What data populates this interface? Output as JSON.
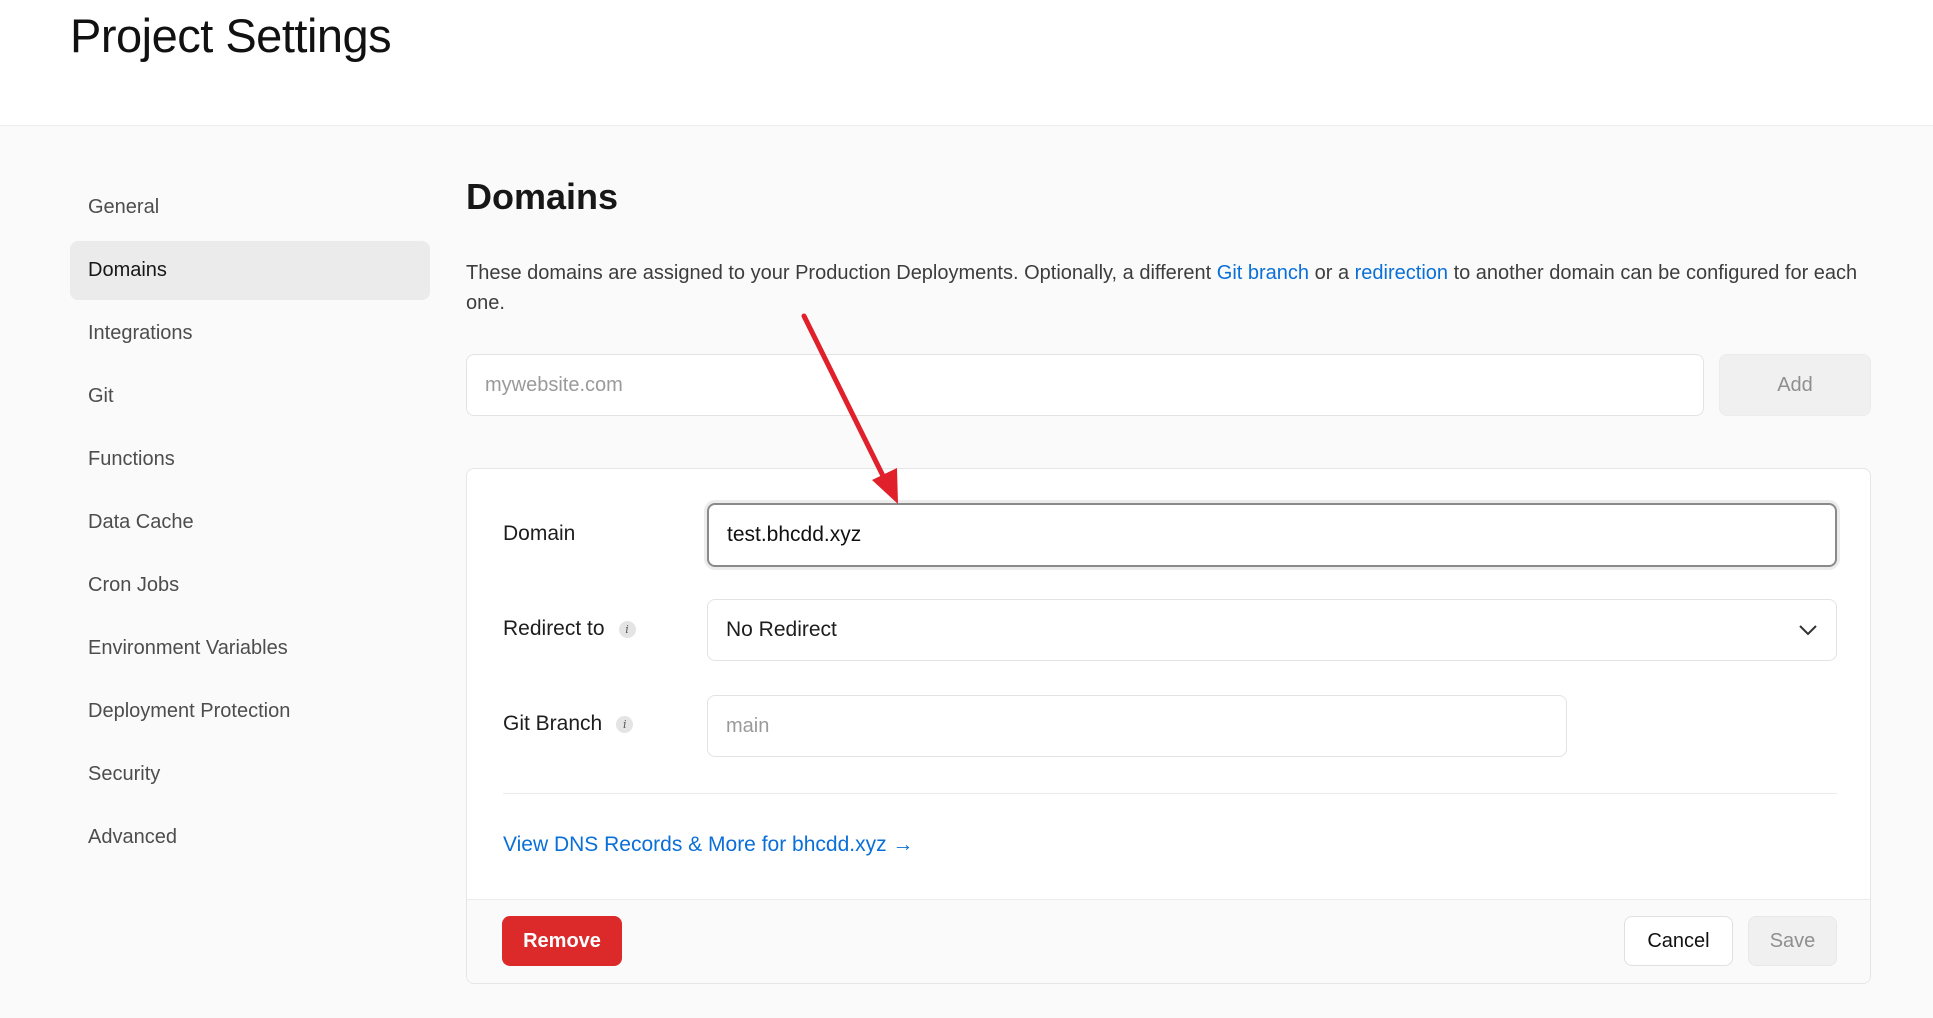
{
  "header": {
    "title": "Project Settings"
  },
  "sidebar": {
    "items": [
      {
        "label": "General",
        "active": false
      },
      {
        "label": "Domains",
        "active": true
      },
      {
        "label": "Integrations",
        "active": false
      },
      {
        "label": "Git",
        "active": false
      },
      {
        "label": "Functions",
        "active": false
      },
      {
        "label": "Data Cache",
        "active": false
      },
      {
        "label": "Cron Jobs",
        "active": false
      },
      {
        "label": "Environment Variables",
        "active": false
      },
      {
        "label": "Deployment Protection",
        "active": false
      },
      {
        "label": "Security",
        "active": false
      },
      {
        "label": "Advanced",
        "active": false
      }
    ]
  },
  "main": {
    "title": "Domains",
    "description_part1": "These domains are assigned to your Production Deployments. Optionally, a different ",
    "description_link1": "Git branch",
    "description_part2": " or a ",
    "description_link2": "redirection",
    "description_part3": " to another domain can be configured for each one.",
    "add_input_placeholder": "mywebsite.com",
    "add_button_label": "Add"
  },
  "domain_card": {
    "domain_label": "Domain",
    "domain_value": "test.bhcdd.xyz",
    "redirect_label": "Redirect to",
    "redirect_value": "No Redirect",
    "git_branch_label": "Git Branch",
    "git_branch_placeholder": "main",
    "dns_link_label": "View DNS Records & More for bhcdd.xyz →",
    "remove_label": "Remove",
    "cancel_label": "Cancel",
    "save_label": "Save"
  },
  "colors": {
    "link": "#0a6fd8",
    "danger": "#dc2a2a",
    "annotation_arrow": "#e0202a"
  }
}
